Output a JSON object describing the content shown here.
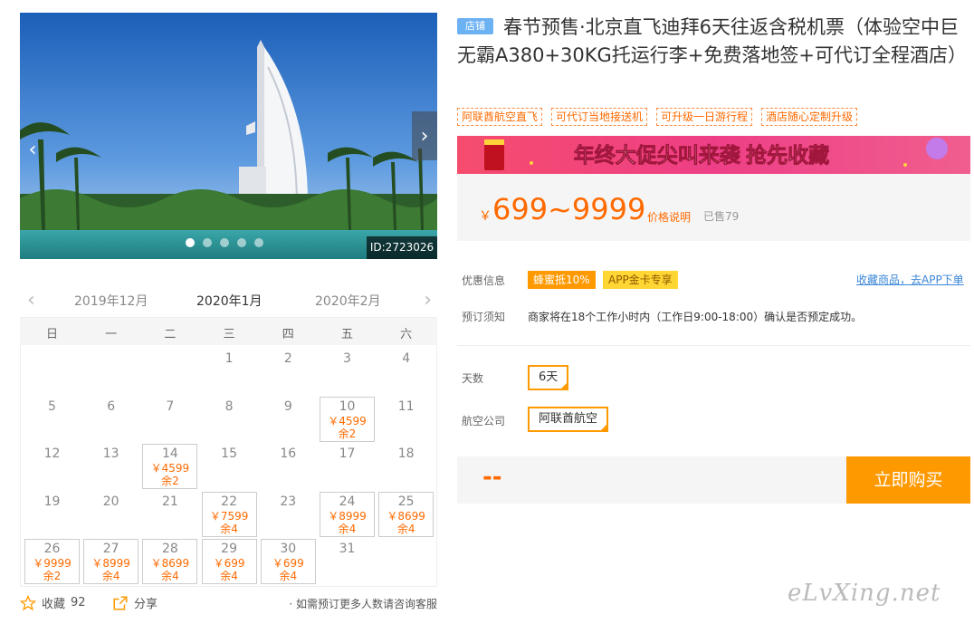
{
  "gallery": {
    "image_id": "ID:2723026",
    "dot_count": 5,
    "active_dot": 0
  },
  "calendar": {
    "months": [
      "2019年12月",
      "2020年1月",
      "2020年2月"
    ],
    "weekdays": [
      "日",
      "一",
      "二",
      "三",
      "四",
      "五",
      "六"
    ],
    "days": [
      {
        "day": "1"
      },
      {
        "day": "2"
      },
      {
        "day": "3"
      },
      {
        "day": "4"
      },
      {
        "day": "5"
      },
      {
        "day": "6"
      },
      {
        "day": "7"
      },
      {
        "day": "8"
      },
      {
        "day": "9"
      },
      {
        "day": "10",
        "price": "￥4599",
        "remain": "余2"
      },
      {
        "day": "11"
      },
      {
        "day": "12"
      },
      {
        "day": "13"
      },
      {
        "day": "14",
        "price": "￥4599",
        "remain": "余2"
      },
      {
        "day": "15"
      },
      {
        "day": "16"
      },
      {
        "day": "17"
      },
      {
        "day": "18"
      },
      {
        "day": "19"
      },
      {
        "day": "20"
      },
      {
        "day": "21"
      },
      {
        "day": "22",
        "price": "￥7599",
        "remain": "余4"
      },
      {
        "day": "23"
      },
      {
        "day": "24",
        "price": "￥8999",
        "remain": "余4"
      },
      {
        "day": "25",
        "price": "￥8699",
        "remain": "余4"
      },
      {
        "day": "26",
        "price": "￥9999",
        "remain": "余2"
      },
      {
        "day": "27",
        "price": "￥8999",
        "remain": "余4"
      },
      {
        "day": "28",
        "price": "￥8699",
        "remain": "余4"
      },
      {
        "day": "29",
        "price": "￥699",
        "remain": "余4"
      },
      {
        "day": "30",
        "price": "￥699",
        "remain": "余4"
      },
      {
        "day": "31"
      }
    ],
    "first_weekday": 3
  },
  "footer": {
    "fav_label": "收藏",
    "fav_count": "92",
    "share_label": "分享",
    "tip": "· 如需预订更多人数请咨询客服"
  },
  "product": {
    "shop_badge": "店铺",
    "title": "春节预售·北京直飞迪拜6天往返含税机票（体验空中巨无霸A380+30KG托运行李+免费落地签+可代订全程酒店）",
    "tags": [
      "阿联酋航空直飞",
      "可代订当地接送机",
      "可升级一日游行程",
      "酒店随心定制升级"
    ],
    "promo_banner": "年终大促尖叫来袭 抢先收藏",
    "currency": "￥",
    "price": "699~9999",
    "price_explain": "价格说明",
    "sold": "已售79",
    "discount_label": "优惠信息",
    "discount_1": "蜂蜜抵10%",
    "discount_2": "APP金卡专享",
    "app_link": "收藏商品，去APP下单",
    "notice_label": "预订须知",
    "notice": "商家将在18个工作小时内（工作日9:00-18:00）确认是否预定成功。",
    "days_label": "天数",
    "days_value": "6天",
    "airline_label": "航空公司",
    "airline_value": "阿联酋航空",
    "total_placeholder": "--",
    "buy_label": "立即购买"
  },
  "watermark": "eLvXing.net",
  "colors": {
    "accent": "#ff9900",
    "price": "#ff6a00",
    "link": "#3a86d8",
    "shop_badge": "#6cb2f3"
  }
}
